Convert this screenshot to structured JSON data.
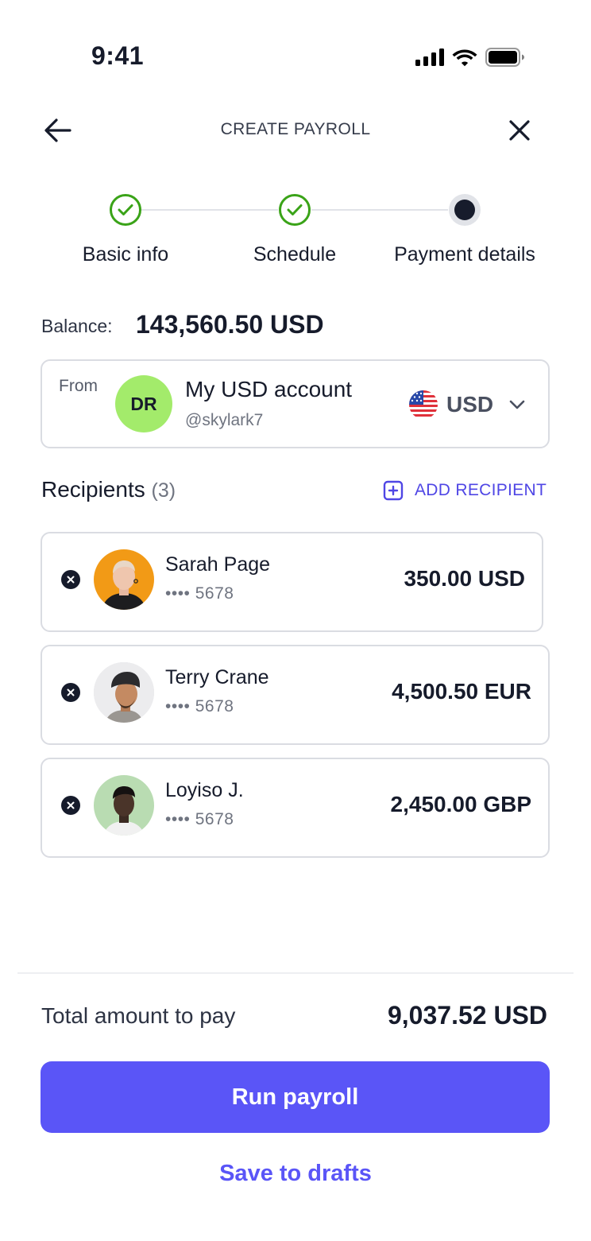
{
  "status_bar": {
    "time": "9:41"
  },
  "header": {
    "title": "CREATE PAYROLL",
    "back_icon": "arrow-left-icon",
    "close_icon": "close-icon"
  },
  "stepper": {
    "steps": [
      {
        "label": "Basic info",
        "state": "completed"
      },
      {
        "label": "Schedule",
        "state": "completed"
      },
      {
        "label": "Payment details",
        "state": "current"
      }
    ]
  },
  "balance": {
    "label": "Balance:",
    "value": "143,560.50 USD"
  },
  "from_account": {
    "label": "From",
    "initials": "DR",
    "name": "My USD account",
    "handle": "@skylark7",
    "currency": "USD",
    "flag_icon": "us-flag-icon"
  },
  "recipients": {
    "title": "Recipients",
    "count": "(3)",
    "add_label": "ADD RECIPIENT",
    "items": [
      {
        "name": "Sarah Page",
        "account": "•••• 5678",
        "amount": "350.00 USD"
      },
      {
        "name": "Terry Crane",
        "account": "•••• 5678",
        "amount": "4,500.50 EUR"
      },
      {
        "name": "Loyiso J.",
        "account": "•••• 5678",
        "amount": "2,450.00 GBP"
      }
    ]
  },
  "footer": {
    "total_label": "Total amount to pay",
    "total_value": "9,037.52 USD",
    "primary_button": "Run payroll",
    "secondary_button": "Save to drafts"
  },
  "colors": {
    "accent": "#5a55f7",
    "link": "#4f46e5",
    "success": "#3aa318",
    "avatar_green": "#a3eb6b"
  }
}
